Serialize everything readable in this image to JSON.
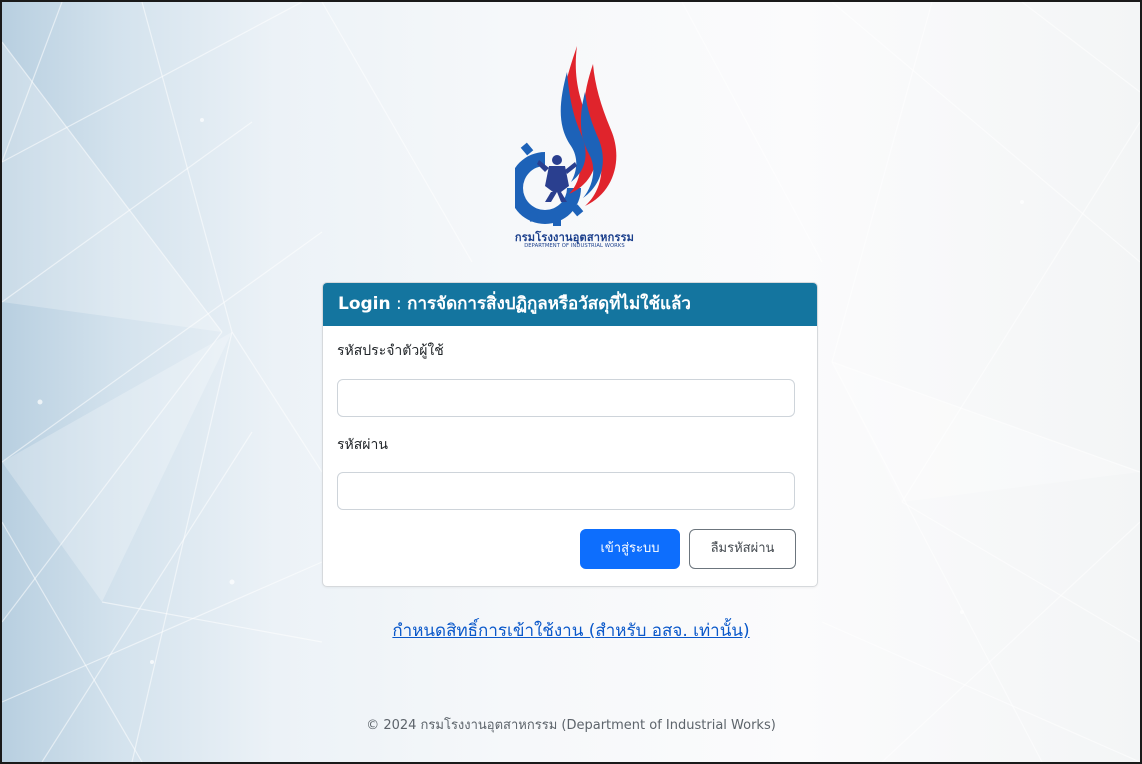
{
  "logo": {
    "name_th": "กรมโรงงานอุตสาหกรรม",
    "name_en": "DEPARTMENT OF INDUSTRIAL WORKS"
  },
  "login": {
    "title_prefix": "Login",
    "title_separator": " : ",
    "title_subtitle": "การจัดการสิ่งปฏิกูลหรือวัสดุที่ไม่ใช้แล้ว",
    "username_label": "รหัสประจำตัวผู้ใช้",
    "username_value": "",
    "password_label": "รหัสผ่าน",
    "password_value": "",
    "submit_label": "เข้าสู่ระบบ",
    "forgot_label": "ลืมรหัสผ่าน"
  },
  "rights_link": "กำหนดสิทธิ์การเข้าใช้งาน (สำหรับ อสจ. เท่านั้น)",
  "footer": "© 2024 กรมโรงงานอุตสาหกรรม (Department of Industrial Works)",
  "colors": {
    "header_bg": "#14759f",
    "primary_button": "#0d6efd",
    "link": "#0a58ca",
    "logo_red": "#e0242c",
    "logo_blue": "#1d62b8",
    "logo_navy": "#1b3f8c"
  },
  "icons": [
    "diw-logo-emblem"
  ]
}
